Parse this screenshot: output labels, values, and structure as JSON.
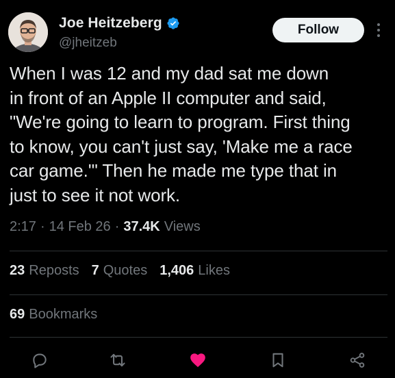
{
  "author": {
    "name": "Joe Heitzeberg",
    "handle": "@jheitzeb",
    "verified": true
  },
  "follow_label": "Follow",
  "tweet": {
    "lines": [
      "When I was 12 and my dad sat me down",
      "in front of an Apple II computer and said,",
      "\"We're going to learn to program. First thing",
      "to know, you can't just say, 'Make me a race",
      "car game.'\" Then he made me type that in",
      "just to see it not work."
    ]
  },
  "meta": {
    "time": "2:17",
    "sep1": "·",
    "date": "14 Feb 26",
    "sep2": "·",
    "views_count": "37.4K",
    "views_label": "Views"
  },
  "stats": {
    "reposts_count": "23",
    "reposts_label": "Reposts",
    "quotes_count": "7",
    "quotes_label": "Quotes",
    "likes_count": "1,406",
    "likes_label": "Likes",
    "bookmarks_count": "69",
    "bookmarks_label": "Bookmarks"
  },
  "actions": {
    "reply": "reply-icon",
    "repost": "repost-icon",
    "like": "heart-icon",
    "like_active": true,
    "bookmark": "bookmark-icon",
    "share": "share-icon"
  },
  "colors": {
    "background": "#000000",
    "text": "#e7e9ea",
    "muted": "#71767b",
    "divider": "#2f3336",
    "verified": "#1d9bf0",
    "like": "#f91880",
    "follow_bg": "#eff3f4"
  }
}
